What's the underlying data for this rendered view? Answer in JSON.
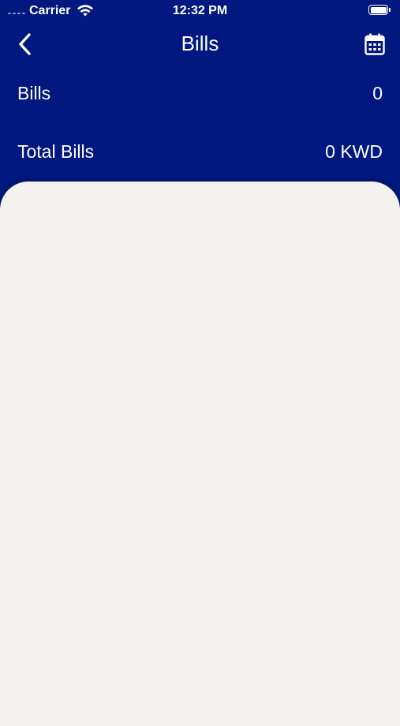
{
  "status_bar": {
    "carrier": "Carrier",
    "time": "12:32 PM",
    "icons": [
      "signal-dots-icon",
      "wifi-icon",
      "battery-icon"
    ]
  },
  "nav": {
    "title": "Bills",
    "back_icon": "chevron-left-icon",
    "calendar_icon": "calendar-icon"
  },
  "summary": {
    "bills_label": "Bills",
    "bills_value": "0",
    "total_label": "Total Bills",
    "total_value": "0 KWD"
  },
  "colors": {
    "header_background": "#001880",
    "content_background": "#f4f1ef",
    "text": "#ffffff"
  }
}
